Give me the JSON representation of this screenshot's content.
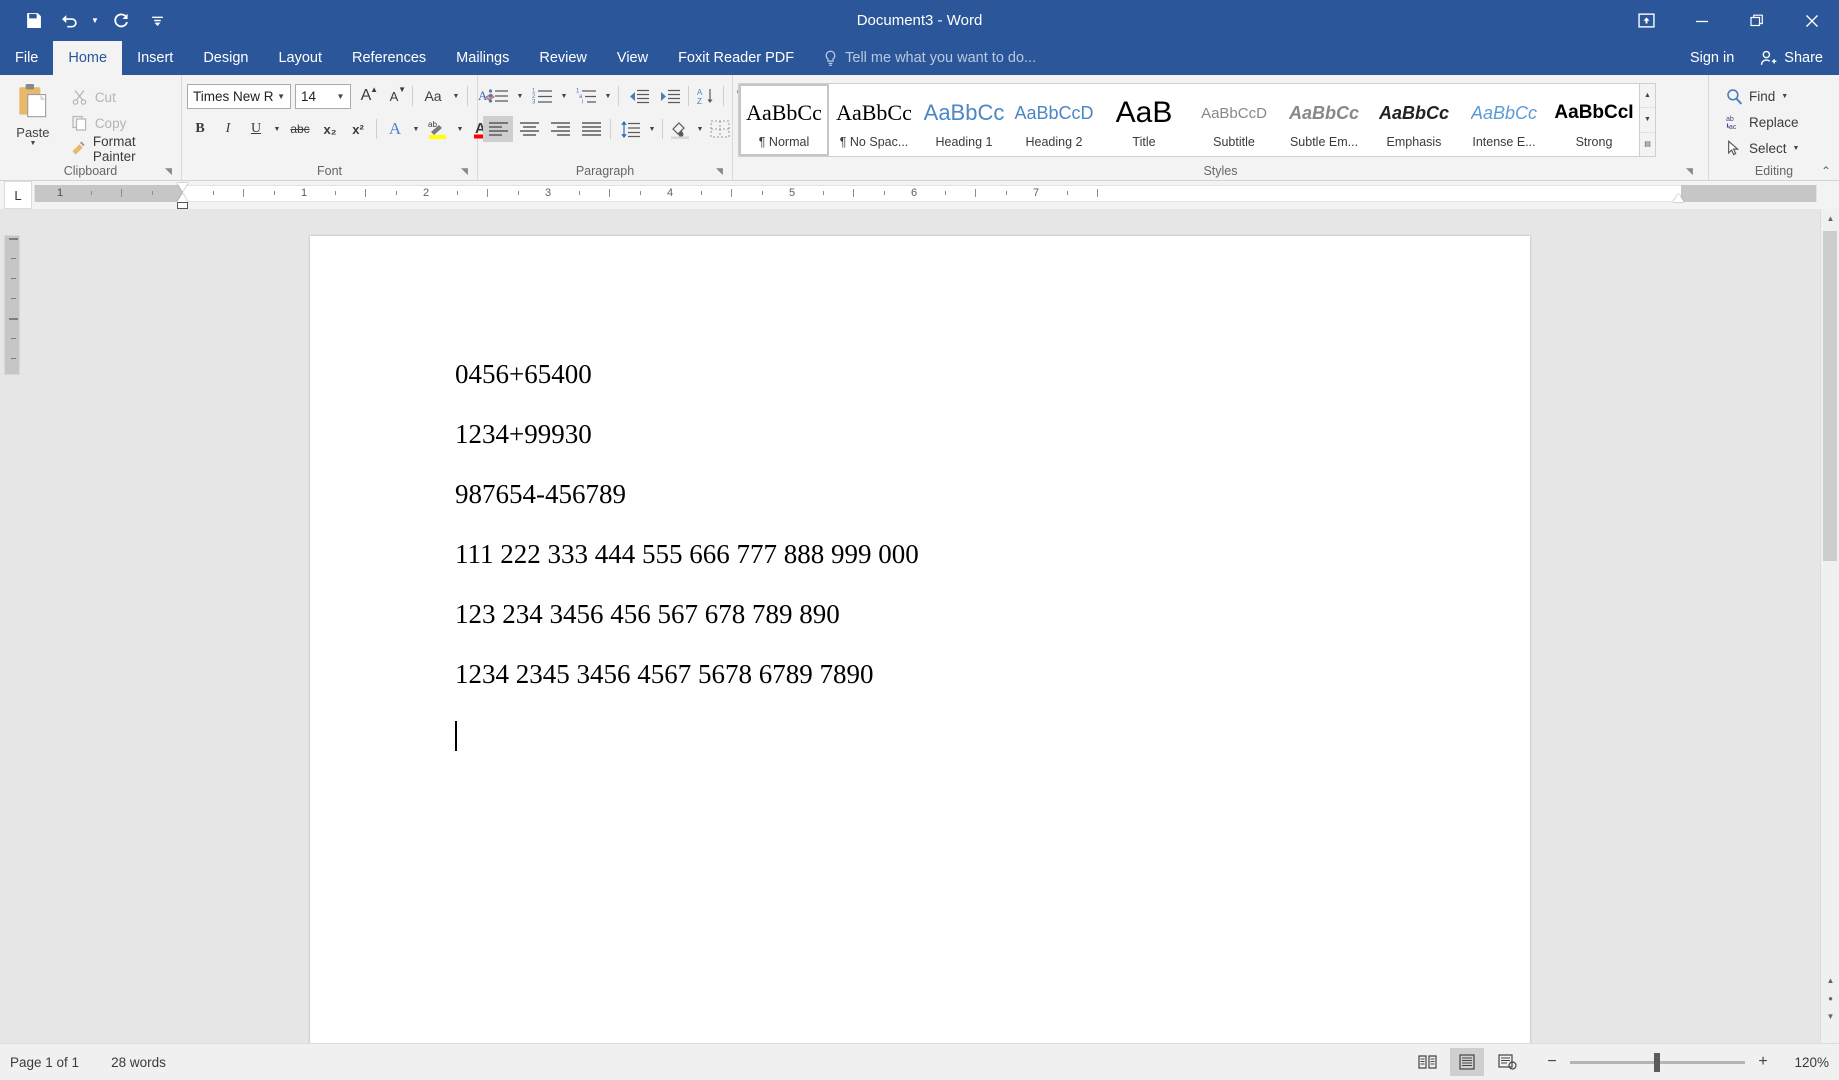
{
  "titlebar": {
    "title": "Document3 - Word",
    "quick_access": [
      {
        "name": "save-icon",
        "label": "Save"
      },
      {
        "name": "undo-icon",
        "label": "Undo"
      },
      {
        "name": "redo-icon",
        "label": "Redo"
      },
      {
        "name": "customize-quick-access-icon",
        "label": "Customize Quick Access Toolbar"
      }
    ],
    "window_controls": [
      {
        "name": "ribbon-display-options-icon",
        "label": "Ribbon Display Options"
      },
      {
        "name": "minimize-icon",
        "label": "Minimize"
      },
      {
        "name": "restore-icon",
        "label": "Restore Down"
      },
      {
        "name": "close-icon",
        "label": "Close"
      }
    ]
  },
  "tabs": [
    {
      "label": "File",
      "active": false
    },
    {
      "label": "Home",
      "active": true
    },
    {
      "label": "Insert",
      "active": false
    },
    {
      "label": "Design",
      "active": false
    },
    {
      "label": "Layout",
      "active": false
    },
    {
      "label": "References",
      "active": false
    },
    {
      "label": "Mailings",
      "active": false
    },
    {
      "label": "Review",
      "active": false
    },
    {
      "label": "View",
      "active": false
    },
    {
      "label": "Foxit Reader PDF",
      "active": false
    }
  ],
  "tellme": {
    "placeholder": "Tell me what you want to do..."
  },
  "account": {
    "signin": "Sign in",
    "share": "Share"
  },
  "ribbon": {
    "groups": [
      {
        "label": "Clipboard"
      },
      {
        "label": "Font"
      },
      {
        "label": "Paragraph"
      },
      {
        "label": "Styles"
      },
      {
        "label": "Editing"
      }
    ],
    "clipboard": {
      "paste": "Paste",
      "cut": "Cut",
      "copy": "Copy",
      "format_painter": "Format Painter"
    },
    "font": {
      "font_name": "Times New Ro",
      "font_size": "14",
      "grow_font": "Grow Font",
      "shrink_font": "Shrink Font",
      "change_case": "Aa",
      "clear_formatting": "Clear All Formatting",
      "bold": "B",
      "italic": "I",
      "underline": "U",
      "strikethrough": "abc",
      "subscript": "x₂",
      "superscript": "x²",
      "text_effects": "A",
      "highlight": "Text Highlight Color",
      "font_color": "A",
      "highlight_color": "#ffff00",
      "font_color_swatch": "#ff0000"
    },
    "paragraph": {
      "bullets": "Bullets",
      "numbering": "Numbering",
      "multilevel": "Multilevel List",
      "decrease_indent": "Decrease Indent",
      "increase_indent": "Increase Indent",
      "sort": "Sort",
      "show_marks": "¶",
      "align_left": "Align Left",
      "align_center": "Center",
      "align_right": "Align Right",
      "justify": "Justify",
      "line_spacing": "Line and Paragraph Spacing",
      "shading": "Shading",
      "borders": "Borders"
    },
    "styles": [
      {
        "preview": "AaBbCc",
        "name": "¶ Normal",
        "selected": true,
        "style": "serif-black"
      },
      {
        "preview": "AaBbCc",
        "name": "¶ No Spac...",
        "selected": false,
        "style": "serif-black"
      },
      {
        "preview": "AaBbCc",
        "name": "Heading 1",
        "selected": false,
        "style": "sans-blue"
      },
      {
        "preview": "AaBbCcD",
        "name": "Heading 2",
        "selected": false,
        "style": "sans-blue-sm"
      },
      {
        "preview": "AaB",
        "name": "Title",
        "selected": false,
        "style": "sans-title"
      },
      {
        "preview": "AaBbCcD",
        "name": "Subtitle",
        "selected": false,
        "style": "sans-gray"
      },
      {
        "preview": "AaBbCc",
        "name": "Subtle Em...",
        "selected": false,
        "style": "sans-italic-gray"
      },
      {
        "preview": "AaBbCc",
        "name": "Emphasis",
        "selected": false,
        "style": "sans-italic-dark"
      },
      {
        "preview": "AaBbCc",
        "name": "Intense E...",
        "selected": false,
        "style": "sans-italic-blue"
      },
      {
        "preview": "AaBbCcI",
        "name": "Strong",
        "selected": false,
        "style": "sans-bold"
      }
    ],
    "editing": {
      "find": "Find",
      "replace": "Replace",
      "select": "Select"
    },
    "collapse": "Collapse the Ribbon"
  },
  "ruler": {
    "tab_selector": "L",
    "numbers": [
      "1",
      "1",
      "2",
      "3",
      "4",
      "5",
      "6",
      "7"
    ],
    "left_indent_in": 0.0,
    "right_indent_in": 6.5
  },
  "document": {
    "lines": [
      "0456+65400",
      "1234+99930",
      "987654-456789",
      "111 222 333 444 555 666 777 888 999 000",
      "123 234 3456 456 567 678 789 890",
      "1234 2345 3456 4567 5678 6789 7890"
    ]
  },
  "statusbar": {
    "page": "Page 1 of 1",
    "words": "28 words",
    "views": [
      {
        "name": "read-mode-icon",
        "label": "Read Mode",
        "active": false
      },
      {
        "name": "print-layout-icon",
        "label": "Print Layout",
        "active": true
      },
      {
        "name": "web-layout-icon",
        "label": "Web Layout",
        "active": false
      }
    ],
    "zoom_out": "−",
    "zoom_in": "+",
    "zoom_level": "120%"
  },
  "colors": {
    "brand_blue": "#2b579a",
    "ribbon_bg": "#f3f3f3",
    "workspace_bg": "#e6e6e6",
    "page_bg": "#ffffff"
  }
}
